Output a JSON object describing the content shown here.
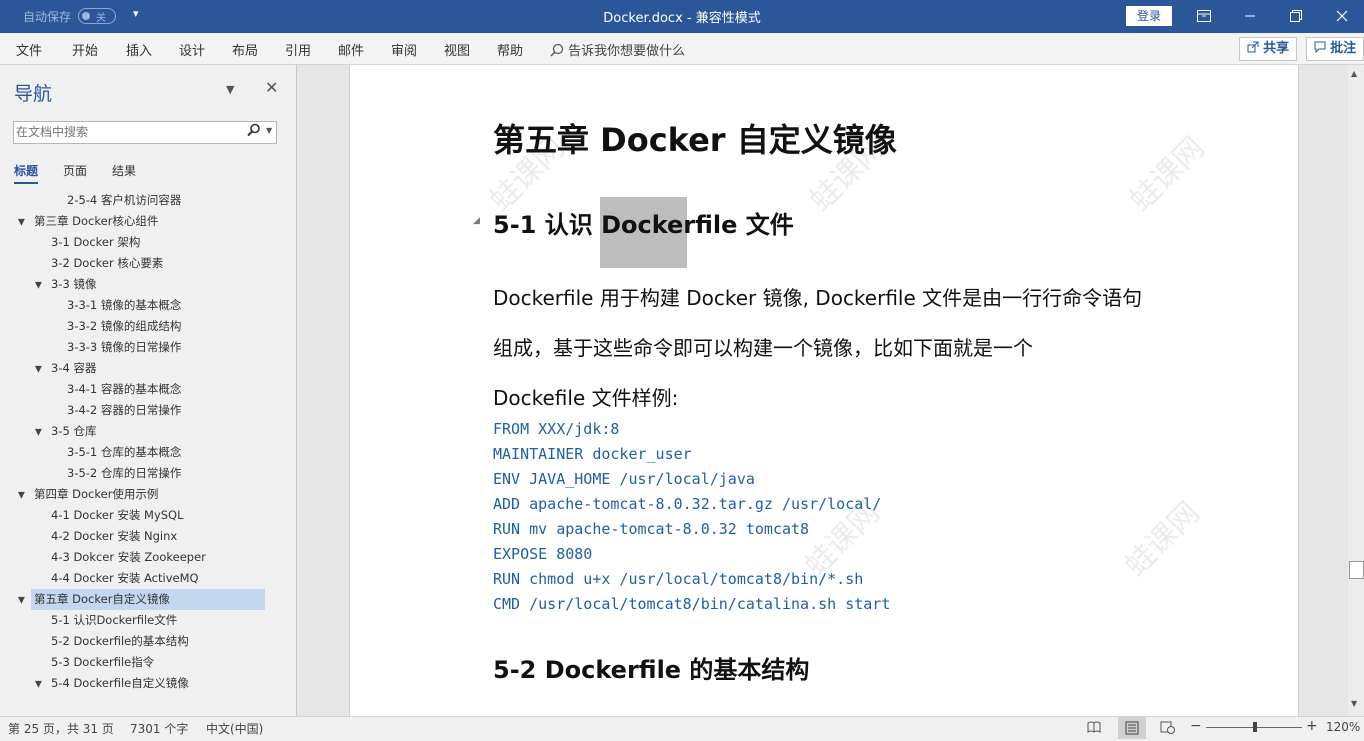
{
  "titlebar": {
    "autosave_label": "自动保存",
    "autosave_state": "关",
    "qat_icon": "▾",
    "title": "Docker.docx  -  兼容性模式",
    "login_label": "登录",
    "icons": {
      "ribbon_display": "ribbon-display-icon",
      "minimize": "minimize-icon",
      "restore": "restore-icon",
      "close": "close-icon"
    }
  },
  "ribbon": {
    "tabs": [
      "文件",
      "开始",
      "插入",
      "设计",
      "布局",
      "引用",
      "邮件",
      "审阅",
      "视图",
      "帮助"
    ],
    "tell_me": "告诉我你想要做什么",
    "share_label": "共享",
    "comment_label": "批注"
  },
  "nav": {
    "title": "导航",
    "search_placeholder": "在文档中搜索",
    "tabs": [
      "标题",
      "页面",
      "结果"
    ],
    "items": [
      {
        "label": "2-5-4 客户机访问容器",
        "level": 3,
        "toggle": ""
      },
      {
        "label": "第三章 Docker核心组件",
        "level": 1,
        "toggle": "▲"
      },
      {
        "label": "3-1 Docker 架构",
        "level": 2,
        "toggle": ""
      },
      {
        "label": "3-2 Docker 核心要素",
        "level": 2,
        "toggle": ""
      },
      {
        "label": "3-3 镜像",
        "level": 2,
        "toggle": "▲"
      },
      {
        "label": "3-3-1 镜像的基本概念",
        "level": 3,
        "toggle": ""
      },
      {
        "label": "3-3-2 镜像的组成结构",
        "level": 3,
        "toggle": ""
      },
      {
        "label": "3-3-3 镜像的日常操作",
        "level": 3,
        "toggle": ""
      },
      {
        "label": "3-4 容器",
        "level": 2,
        "toggle": "▲"
      },
      {
        "label": "3-4-1 容器的基本概念",
        "level": 3,
        "toggle": ""
      },
      {
        "label": "3-4-2 容器的日常操作",
        "level": 3,
        "toggle": ""
      },
      {
        "label": "3-5 仓库",
        "level": 2,
        "toggle": "▲"
      },
      {
        "label": "3-5-1 仓库的基本概念",
        "level": 3,
        "toggle": ""
      },
      {
        "label": "3-5-2 仓库的日常操作",
        "level": 3,
        "toggle": ""
      },
      {
        "label": "第四章 Docker使用示例",
        "level": 1,
        "toggle": "▲"
      },
      {
        "label": "4-1 Docker 安装 MySQL",
        "level": 2,
        "toggle": ""
      },
      {
        "label": "4-2 Docker 安装 Nginx",
        "level": 2,
        "toggle": ""
      },
      {
        "label": "4-3 Dokcer 安装 Zookeeper",
        "level": 2,
        "toggle": ""
      },
      {
        "label": "4-4 Docker 安装 ActiveMQ",
        "level": 2,
        "toggle": ""
      },
      {
        "label": "第五章 Docker自定义镜像",
        "level": 1,
        "toggle": "▲",
        "selected": true
      },
      {
        "label": "5-1 认识Dockerfile文件",
        "level": 2,
        "toggle": ""
      },
      {
        "label": "5-2 Dockerfile的基本结构",
        "level": 2,
        "toggle": ""
      },
      {
        "label": "5-3 Dockerfile指令",
        "level": 2,
        "toggle": ""
      },
      {
        "label": "5-4 Dockerfile自定义镜像",
        "level": 2,
        "toggle": "▲"
      }
    ]
  },
  "document": {
    "chapter_title": "第五章  Docker 自定义镜像",
    "section1_title": "5-1  认识 Dockerfile 文件",
    "paragraph_lines": [
      "Dockerfile 用于构建 Docker 镜像, Dockerfile 文件是由一行行命令语句",
      "组成，基于这些命令即可以构建一个镜像，比如下面就是一个",
      "Dockefile 文件样例:"
    ],
    "code_lines": [
      "FROM XXX/jdk:8",
      "MAINTAINER docker_user",
      "ENV JAVA_HOME /usr/local/java",
      "ADD apache-tomcat-8.0.32.tar.gz /usr/local/",
      "RUN mv apache-tomcat-8.0.32 tomcat8",
      "EXPOSE 8080",
      "RUN chmod u+x /usr/local/tomcat8/bin/*.sh",
      "CMD /usr/local/tomcat8/bin/catalina.sh start"
    ],
    "section2_title": "5-2 Dockerfile 的基本结构",
    "watermark": "蛙课网"
  },
  "status": {
    "page_info": "第 25 页，共 31 页",
    "word_count": "7301 个字",
    "language": "中文(中国)",
    "zoom_minus": "−",
    "zoom_plus": "+",
    "zoom_level": "120%"
  }
}
